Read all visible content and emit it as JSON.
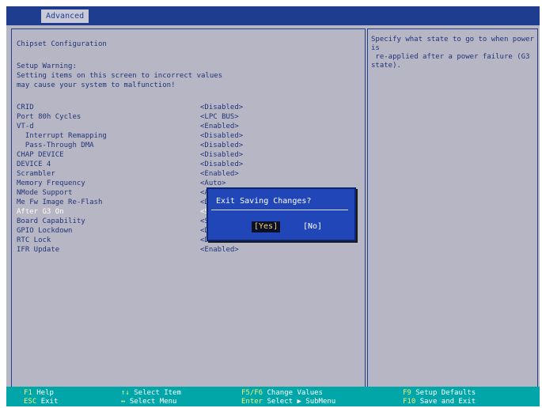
{
  "tabs": {
    "active": "Advanced"
  },
  "panel": {
    "title": "Chipset Configuration",
    "warning_title": "Setup Warning:",
    "warning_line1": "Setting items on this screen to incorrect values",
    "warning_line2": "may cause your system to malfunction!"
  },
  "settings": [
    {
      "label": "CRID",
      "value": "<Disabled>"
    },
    {
      "label": "Port 80h Cycles",
      "value": "<LPC BUS>"
    },
    {
      "label": "VT-d",
      "value": "<Enabled>"
    },
    {
      "label": "  Interrupt Remapping",
      "value": "<Disabled>"
    },
    {
      "label": "  Pass-Through DMA",
      "value": "<Disabled>"
    },
    {
      "label": "CHAP DEVICE",
      "value": "<Disabled>"
    },
    {
      "label": "DEVICE 4",
      "value": "<Disabled>"
    },
    {
      "label": "Scrambler",
      "value": "<Enabled>"
    },
    {
      "label": "Memory Frequency",
      "value": "<Auto>"
    },
    {
      "label": "NMode Support",
      "value": "<A"
    },
    {
      "label": "Me Fw Image Re-Flash",
      "value": "<D"
    },
    {
      "label": "After G3 On",
      "value": "<S"
    },
    {
      "label": "Board Capability",
      "value": "<S"
    },
    {
      "label": "GPIO Lockdown",
      "value": "<D"
    },
    {
      "label": "RTC Lock",
      "value": "<Disabled>"
    },
    {
      "label": "IFR Update",
      "value": "<Enabled>"
    }
  ],
  "help": {
    "text": "Specify what state to go to when power is\n re-applied after a power failure (G3\nstate)."
  },
  "dialog": {
    "title": "Exit Saving Changes?",
    "yes_label": "[Yes]",
    "no_label": "[No]"
  },
  "footer": {
    "f1_key": "F1",
    "f1_label": "Help",
    "f1_key2": "ESC",
    "f1_label2": "Exit",
    "nav_key": "↑↓",
    "nav_label": "Select Item",
    "nav_key2": "↔",
    "nav_label2": "Select Menu",
    "change_key": "F5/F6",
    "change_label": "Change Values",
    "enter_key": "Enter",
    "enter_label": "Select ▶ SubMenu",
    "f9_key": "F9",
    "f9_label": "Setup Defaults",
    "f10_key": "F10",
    "f10_label": "Save and Exit"
  },
  "colors": {
    "background": "#b7b6c4",
    "header_bar": "#1e3d8f",
    "text": "#22357a",
    "dialog": "#2046b8",
    "footer": "#00a6a8"
  }
}
